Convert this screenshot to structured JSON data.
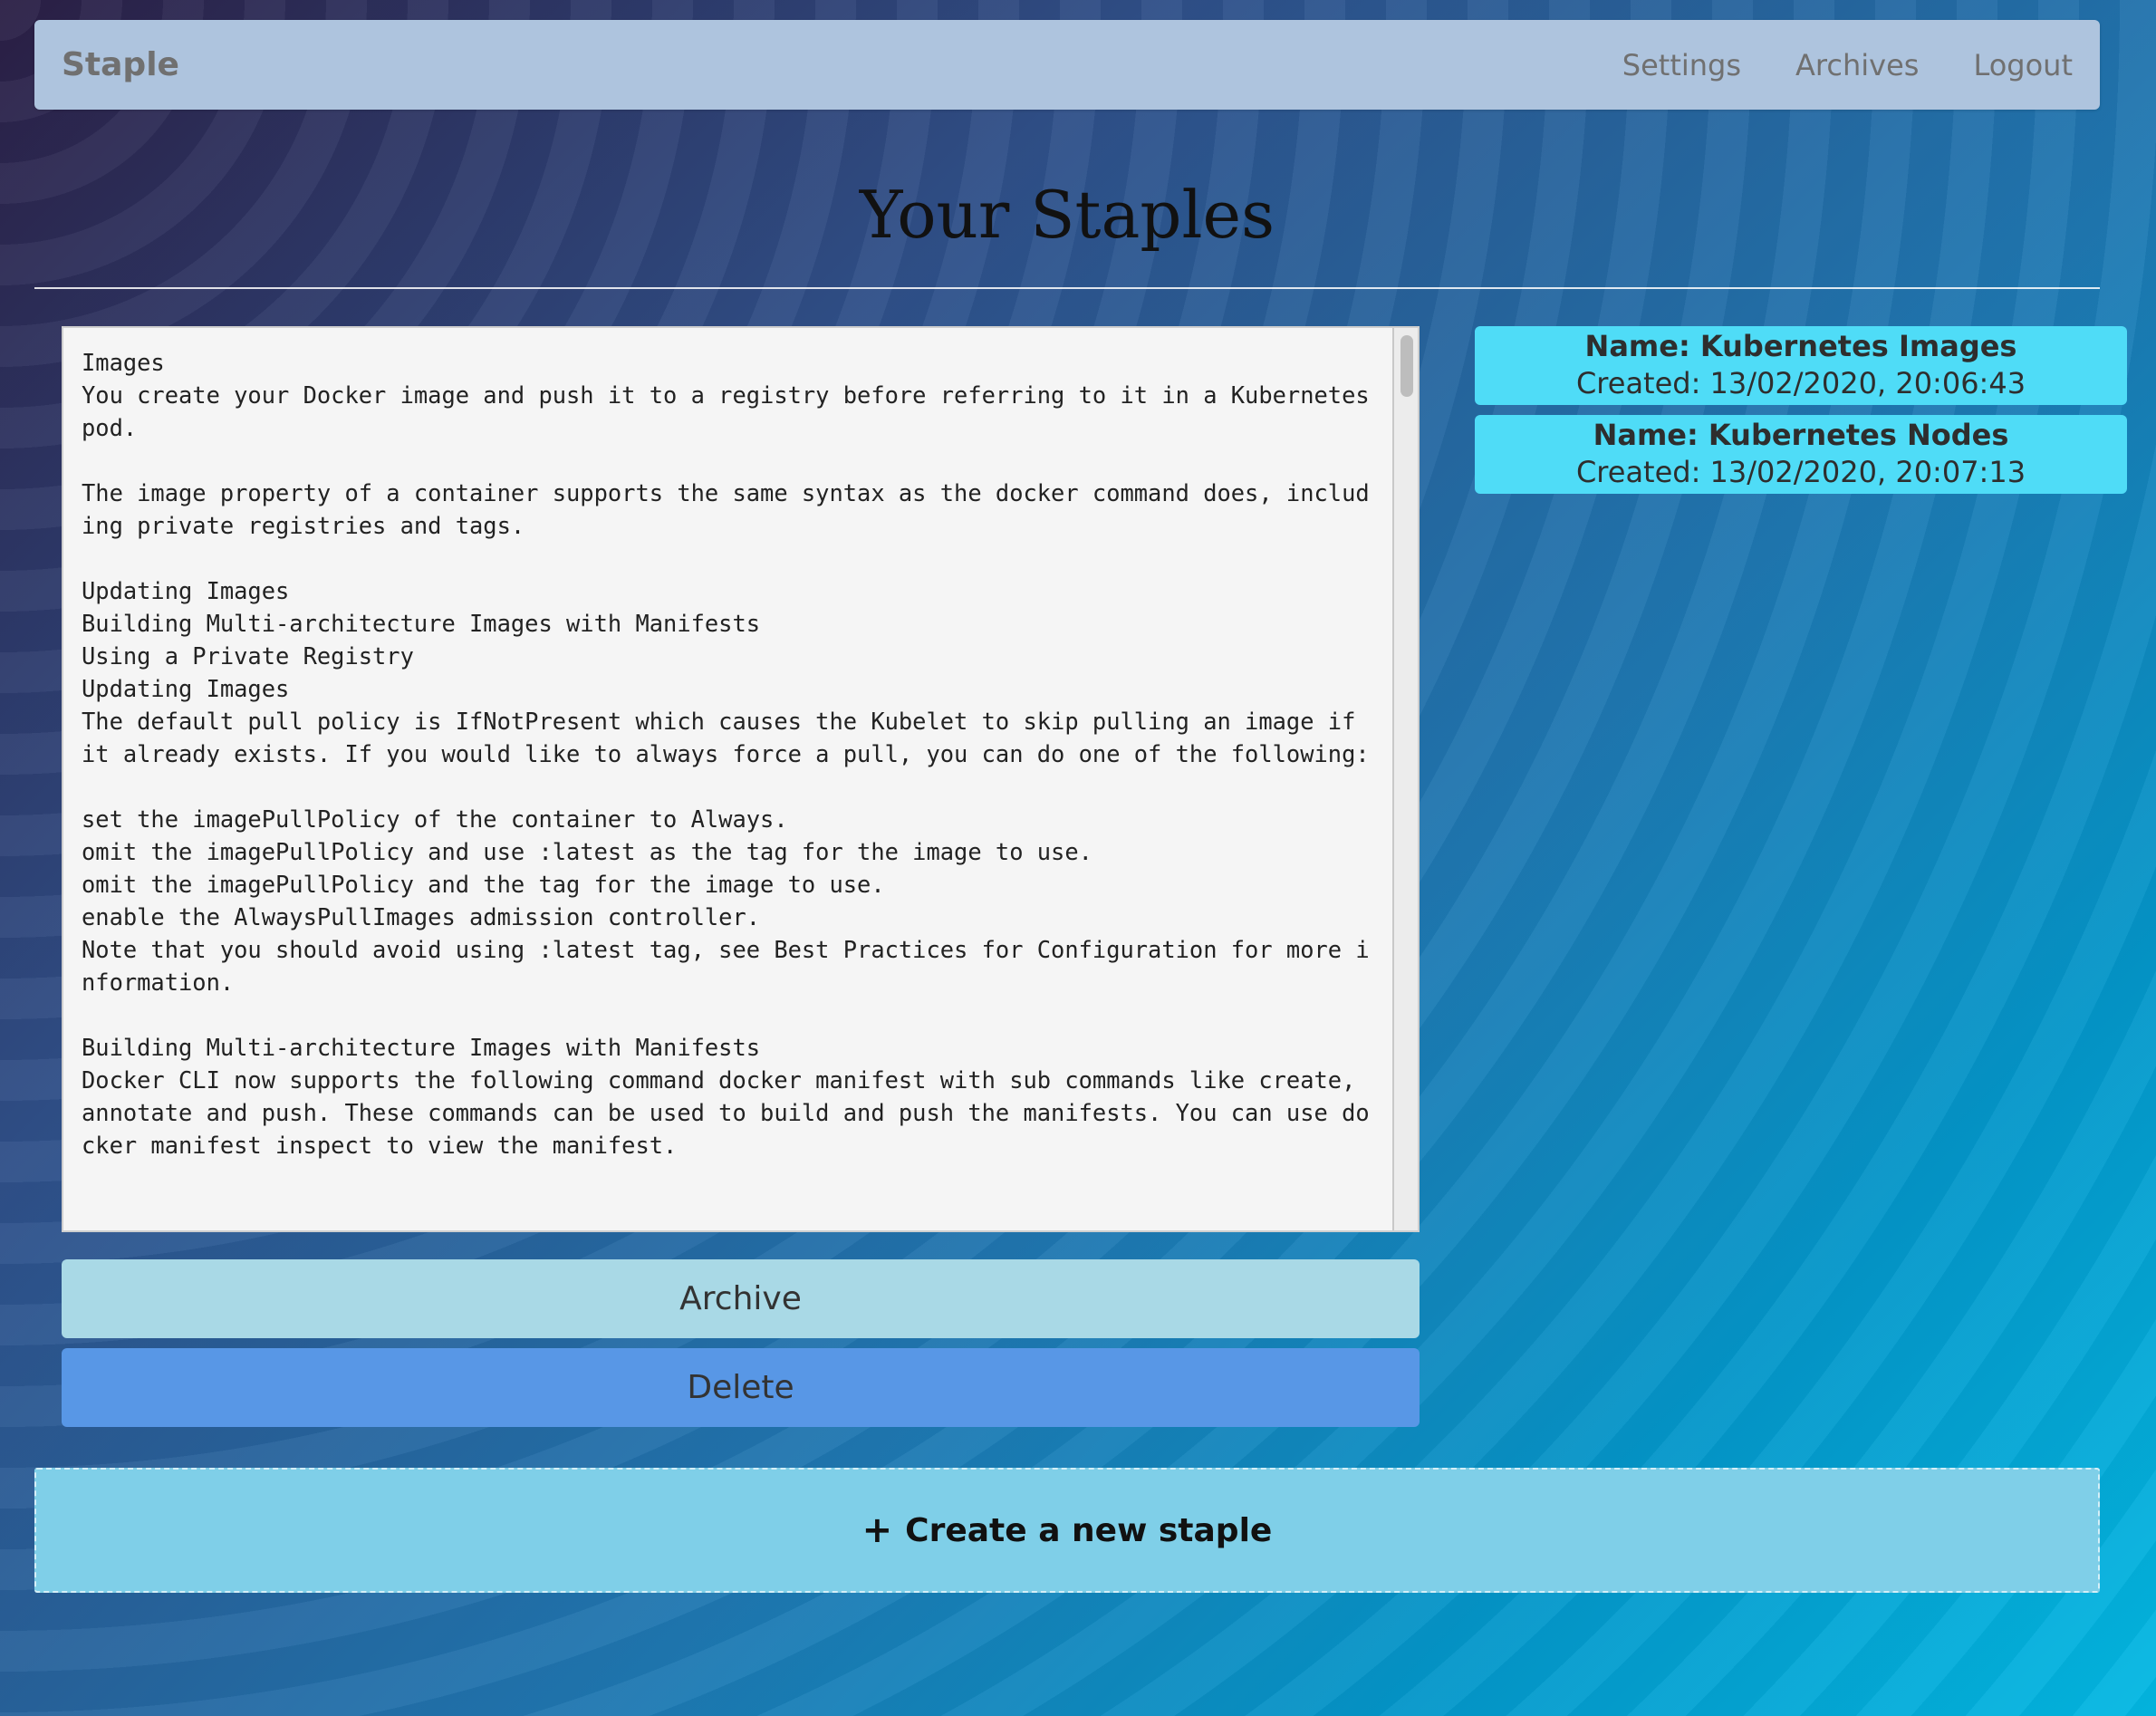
{
  "navbar": {
    "brand": "Staple",
    "links": [
      "Settings",
      "Archives",
      "Logout"
    ]
  },
  "page": {
    "title": "Your Staples"
  },
  "editor": {
    "content": "Images\nYou create your Docker image and push it to a registry before referring to it in a Kubernetes pod.\n\nThe image property of a container supports the same syntax as the docker command does, including private registries and tags.\n\nUpdating Images\nBuilding Multi-architecture Images with Manifests\nUsing a Private Registry\nUpdating Images\nThe default pull policy is IfNotPresent which causes the Kubelet to skip pulling an image if it already exists. If you would like to always force a pull, you can do one of the following:\n\nset the imagePullPolicy of the container to Always.\nomit the imagePullPolicy and use :latest as the tag for the image to use.\nomit the imagePullPolicy and the tag for the image to use.\nenable the AlwaysPullImages admission controller.\nNote that you should avoid using :latest tag, see Best Practices for Configuration for more information.\n\nBuilding Multi-architecture Images with Manifests\nDocker CLI now supports the following command docker manifest with sub commands like create, annotate and push. These commands can be used to build and push the manifests. You can use docker manifest inspect to view the manifest."
  },
  "actions": {
    "archive_label": "Archive",
    "delete_label": "Delete"
  },
  "staples": [
    {
      "name": "Name: Kubernetes Images",
      "created": "Created: 13/02/2020, 20:06:43"
    },
    {
      "name": "Name: Kubernetes Nodes",
      "created": "Created: 13/02/2020, 20:07:13"
    }
  ],
  "create": {
    "icon": "+",
    "label": "Create a new staple"
  },
  "colors": {
    "navbar": "#aec4de",
    "card": "#4fdcf7",
    "archive_button": "#a9d9e6",
    "delete_button": "#5897e6",
    "create_box": "#7fcfe8"
  }
}
